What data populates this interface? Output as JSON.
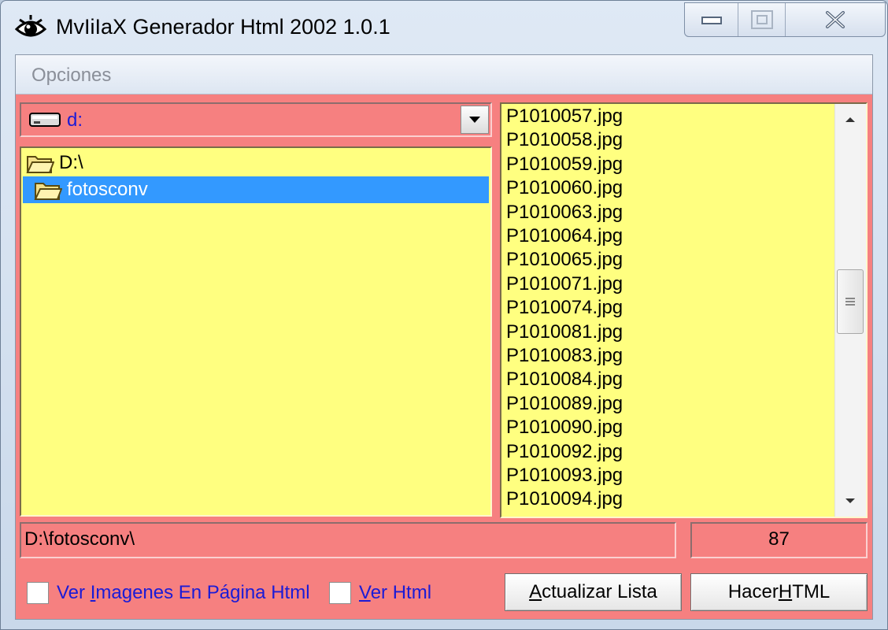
{
  "window": {
    "title": "MvIiIaX Generador Html 2002 1.0.1"
  },
  "menu": {
    "items": [
      "Opciones"
    ]
  },
  "drive": {
    "label": "d:"
  },
  "directories": [
    {
      "label": "D:\\",
      "selected": false
    },
    {
      "label": "fotosconv",
      "selected": true
    }
  ],
  "files": [
    "P1010057.jpg",
    "P1010058.jpg",
    "P1010059.jpg",
    "P1010060.jpg",
    "P1010063.jpg",
    "P1010064.jpg",
    "P1010065.jpg",
    "P1010071.jpg",
    "P1010074.jpg",
    "P1010081.jpg",
    "P1010083.jpg",
    "P1010084.jpg",
    "P1010089.jpg",
    "P1010090.jpg",
    "P1010092.jpg",
    "P1010093.jpg",
    "P1010094.jpg"
  ],
  "status": {
    "path": "D:\\fotosconv\\",
    "count": "87"
  },
  "options": {
    "show_images": {
      "before": "Ver ",
      "accel": "I",
      "after": "magenes En Página Html",
      "checked": false
    },
    "show_html": {
      "before": "",
      "accel": "V",
      "after": "er Html",
      "checked": false
    }
  },
  "buttons": {
    "refresh": {
      "before": "",
      "accel": "A",
      "after": "ctualizar Lista"
    },
    "make_html": {
      "before": "Hacer ",
      "accel": "H",
      "after": "TML"
    }
  },
  "colors": {
    "panel": "#f68080",
    "list_bg": "#ffff80",
    "selection": "#3399ff",
    "label_text": "#1b1bd6"
  }
}
